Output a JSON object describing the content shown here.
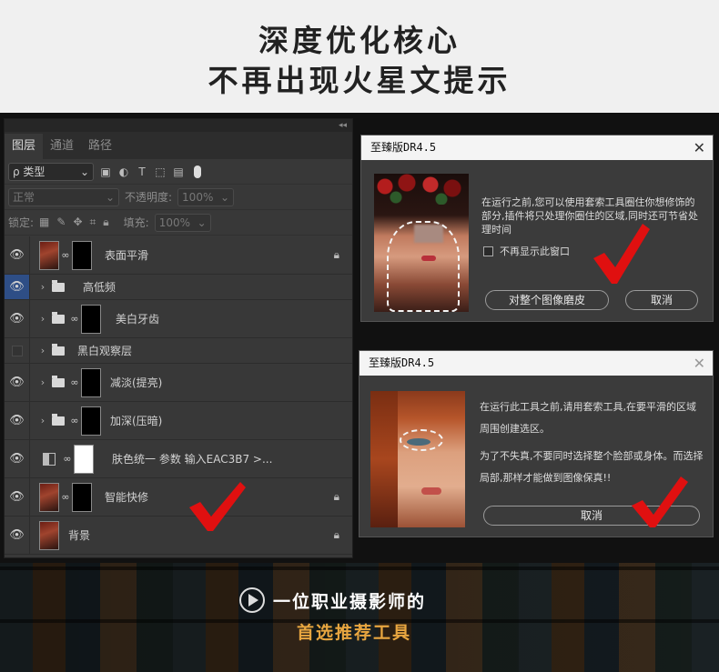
{
  "header": {
    "line1": "深度优化核心",
    "line2": "不再出现火星文提示"
  },
  "layers_panel": {
    "tabs": [
      "图层",
      "通道",
      "路径"
    ],
    "filter_label": "ρ 类型",
    "blend_mode": "正常",
    "opacity_label": "不透明度:",
    "opacity_value": "100%",
    "lock_label": "锁定:",
    "fill_label": "填充:",
    "fill_value": "100%",
    "layers": [
      {
        "name": "表面平滑",
        "locked": true
      },
      {
        "name": "高低频"
      },
      {
        "name": "美白牙齿"
      },
      {
        "name": "黑白观察层"
      },
      {
        "name": "减淡(提亮)"
      },
      {
        "name": "加深(压暗)"
      },
      {
        "name": "肤色统一 参数  输入EAC3B7 >..."
      },
      {
        "name": "智能快修",
        "locked": true
      },
      {
        "name": "背景",
        "locked": true
      }
    ]
  },
  "dialog1": {
    "title": "至臻版DR4.5",
    "message": "在运行之前,您可以使用套索工具圈住你想修饰的部分,插件将只处理你圈住的区域,同时还可节省处理时间",
    "checkbox_label": "不再显示此窗口",
    "primary_button": "对整个图像磨皮",
    "cancel_button": "取消"
  },
  "dialog2": {
    "title": "至臻版DR4.5",
    "message_1": "在运行此工具之前,请用套索工具,在要平滑的区域周围创建选区。",
    "message_2": "为了不失真,不要同时选择整个脸部或身体。而选择局部,那样才能做到图像保真!!",
    "cancel_button": "取消"
  },
  "banner": {
    "line1": "一位职业摄影师的",
    "line2": "首选推荐工具"
  },
  "colors": {
    "accent_orange": "#e8a640",
    "check_red": "#e01010",
    "selected_blue": "#2e4e86"
  }
}
